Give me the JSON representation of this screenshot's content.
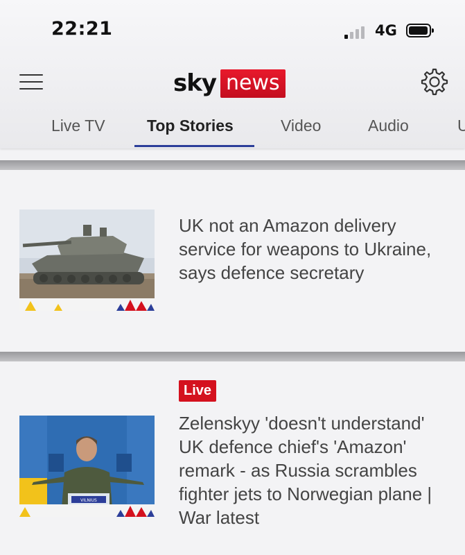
{
  "status_bar": {
    "time": "22:21",
    "network": "4G"
  },
  "header": {
    "logo_sky": "sky",
    "logo_news": "news"
  },
  "tabs": [
    {
      "label": "Live TV"
    },
    {
      "label": "Top Stories",
      "active": true
    },
    {
      "label": "Video"
    },
    {
      "label": "Audio"
    },
    {
      "label": "U"
    }
  ],
  "stories": [
    {
      "headline": "UK not an Amazon delivery service for weapons to Ukraine, says defence secretary",
      "thumbnail": "tank-image"
    },
    {
      "badge": "Live",
      "headline": "Zelenskyy 'doesn't understand' UK defence chief's 'Amazon' remark - as Russia scrambles fighter jets to Norwegian plane | War latest",
      "thumbnail": "zelenskyy-podium-image",
      "thumb_text": {
        "podium": "VILNIUS"
      }
    }
  ],
  "colors": {
    "brand_red": "#d4111e",
    "tab_underline": "#2c3e99"
  }
}
